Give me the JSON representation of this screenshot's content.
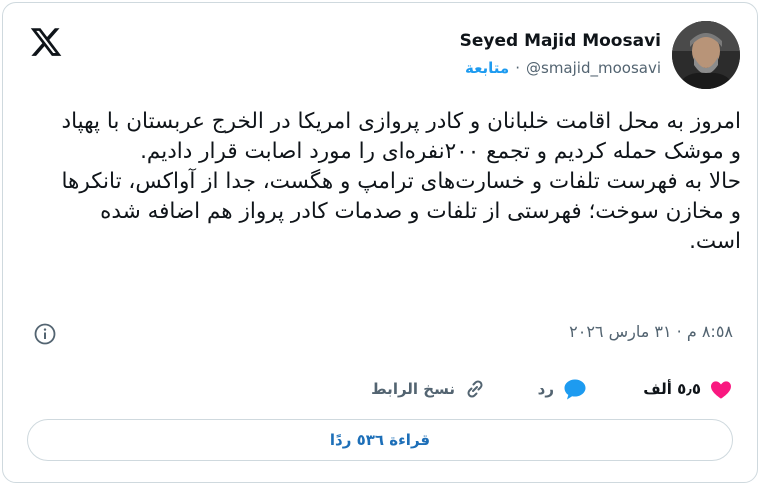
{
  "author": {
    "display_name": "Seyed Majid Moosavi",
    "handle": "@smajid_moosavi",
    "separator": "·",
    "follow_label": "متابعة"
  },
  "tweet": {
    "text": "امروز به محل اقامت خلبانان و کادر پروازی امریکا در الخرج عربستان با پهپاد و موشک حمله کردیم و تجمع ۲۰۰نفره‌ای را مورد اصابت قرار دادیم.\nحالا به فهرست تلفات و خسارت‌های ترامپ و هگست، جدا از آواکس، تانکرها و مخازن سوخت؛ فهرستی از تلفات و صدمات کادر پرواز هم اضافه شده است.",
    "timestamp": "٨:٥٨ م · ٣١ مارس ٢٠٢٦"
  },
  "actions": {
    "like_count": "٥٫٥ ألف",
    "reply_label": "رد",
    "copy_link_label": "نسخ الرابط"
  },
  "replies_button": {
    "label": "قراءة ٥٣٦ ردًا"
  },
  "colors": {
    "like": "#f91880",
    "reply": "#1d9bf0",
    "link": "#1d9bf0"
  }
}
